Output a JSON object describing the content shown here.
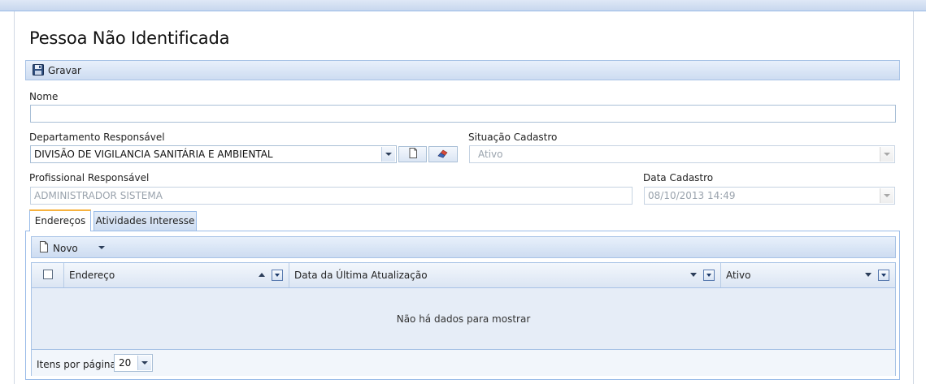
{
  "page": {
    "title": "Pessoa Não Identificada"
  },
  "toolbar": {
    "save_label": "Gravar"
  },
  "form": {
    "nome": {
      "label": "Nome",
      "value": ""
    },
    "departamento": {
      "label": "Departamento Responsável",
      "value": "DIVISÃO DE VIGILANCIA SANITÁRIA E AMBIENTAL"
    },
    "situacao": {
      "label": "Situação Cadastro",
      "value": "Ativo"
    },
    "profissional": {
      "label": "Profissional Responsável",
      "value": "ADMINISTRADOR SISTEMA"
    },
    "data_cadastro": {
      "label": "Data Cadastro",
      "value": "08/10/2013 14:49"
    }
  },
  "tabs": [
    {
      "label": "Endereços",
      "active": true
    },
    {
      "label": "Atividades Interesse",
      "active": false
    }
  ],
  "grid": {
    "toolbar": {
      "new_label": "Novo"
    },
    "columns": [
      "Endereço",
      "Data da Última Atualização",
      "Ativo"
    ],
    "empty_text": "Não há dados para mostrar",
    "pager": {
      "items_per_page_label": "Itens por página:",
      "items_per_page_value": "20"
    }
  },
  "colors": {
    "accent_tab": "#f7b23e",
    "border": "#99bbe8",
    "toolbar_bg": "#cddcf1"
  },
  "icons": [
    "floppy-disk-icon",
    "new-document-icon",
    "eraser-icon",
    "dropdown-arrow-icon",
    "sort-asc-icon",
    "sort-desc-icon",
    "column-menu-icon"
  ]
}
